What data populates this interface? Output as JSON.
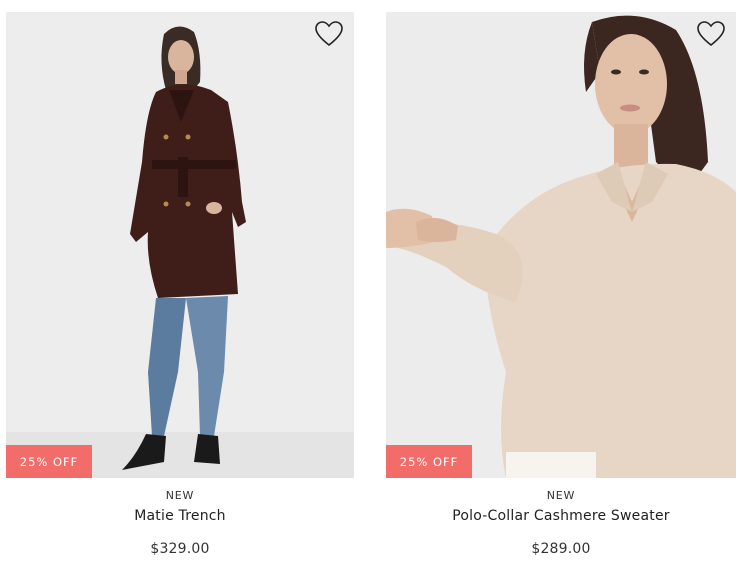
{
  "products": [
    {
      "tag": "NEW",
      "name": "Matie Trench",
      "price": "$329.00",
      "badge": "25% OFF",
      "icon": "heart-outline-icon"
    },
    {
      "tag": "NEW",
      "name": "Polo-Collar Cashmere Sweater",
      "price": "$289.00",
      "badge": "25% OFF",
      "icon": "heart-outline-icon"
    }
  ],
  "colors": {
    "badge": "#f26d6a",
    "trench": "#3f1e1a",
    "sweater": "#e7d6c5",
    "backdrop": "#ececec"
  }
}
